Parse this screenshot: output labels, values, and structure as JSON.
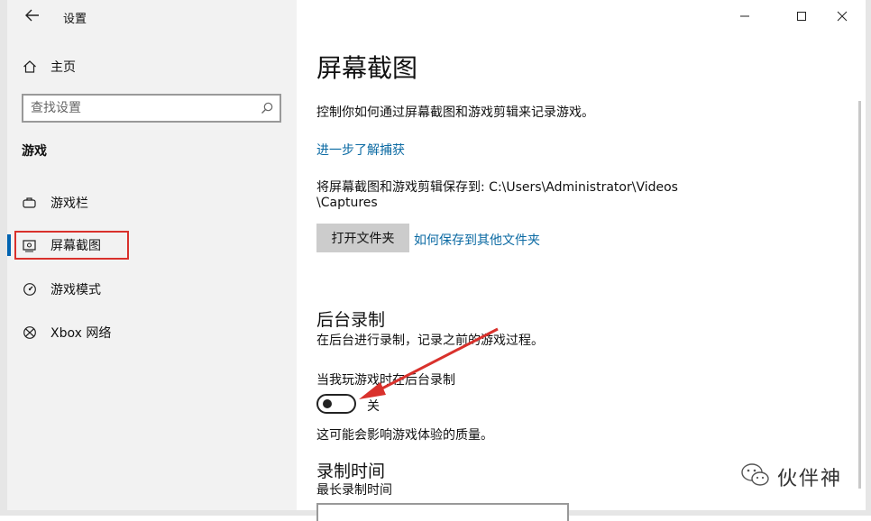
{
  "window": {
    "title": "设置",
    "controls": [
      "minimize",
      "maximize",
      "close"
    ]
  },
  "sidebar": {
    "home_label": "主页",
    "search_placeholder": "查找设置",
    "section_title": "游戏",
    "items": [
      {
        "label": "游戏栏",
        "icon": "game-bar-icon",
        "selected": false
      },
      {
        "label": "屏幕截图",
        "icon": "captures-icon",
        "selected": true
      },
      {
        "label": "游戏模式",
        "icon": "game-mode-icon",
        "selected": false
      },
      {
        "label": "Xbox 网络",
        "icon": "xbox-icon",
        "selected": false
      }
    ]
  },
  "main": {
    "title": "屏幕截图",
    "description": "控制你如何通过屏幕截图和游戏剪辑来记录游戏。",
    "learn_more_link": "进一步了解捕获",
    "save_path_line1": "将屏幕截图和游戏剪辑保存到: C:\\Users\\Administrator\\Videos",
    "save_path_line2": "\\Captures",
    "open_folder_button": "打开文件夹",
    "save_elsewhere_link": "如何保存到其他文件夹",
    "background_recording": {
      "heading": "后台录制",
      "description": "在后台进行录制，记录之前的游戏过程。",
      "toggle_caption": "当我玩游戏时在后台录制",
      "toggle_state": "关",
      "toggle_on": false,
      "note": "这可能会影响游戏体验的质量。"
    },
    "record_time": {
      "heading": "录制时间",
      "label": "最长录制时间"
    }
  },
  "watermark": {
    "text": "伙伴神",
    "icon": "wechat-icon"
  },
  "colors": {
    "accent": "#0063b1",
    "link": "#0b6aa3",
    "highlight": "#d9312c",
    "sidebar_bg": "#f2f2f2",
    "button_bg": "#cccccc"
  }
}
